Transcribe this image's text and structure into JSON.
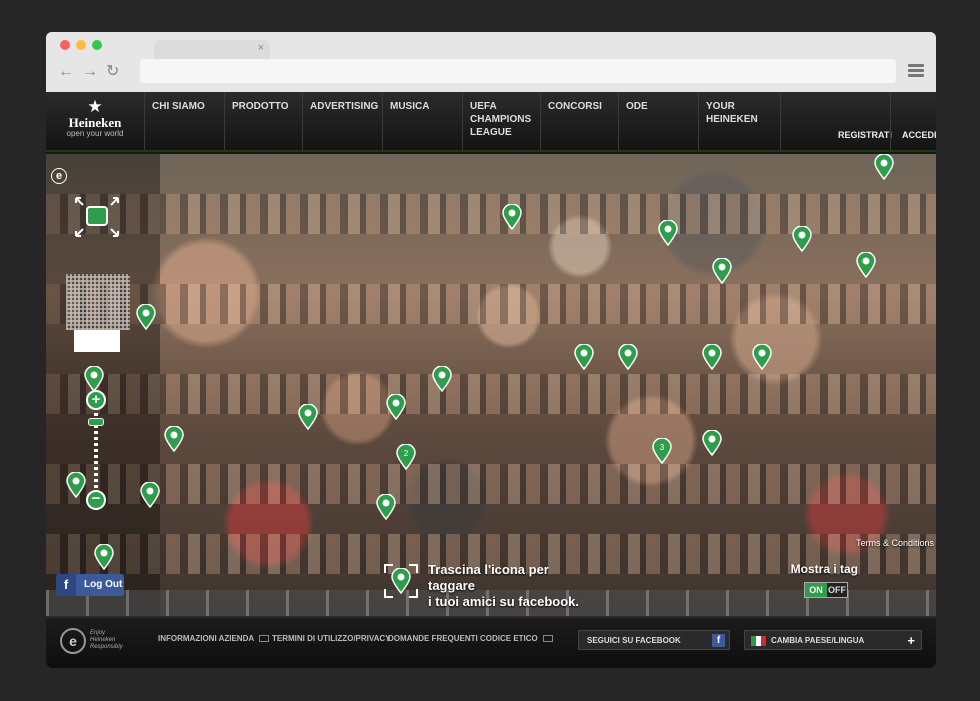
{
  "browser": {
    "tab_close": "×",
    "nav": {
      "back": "←",
      "forward": "→",
      "reload": "↻"
    }
  },
  "header": {
    "logo": {
      "brand": "Heineken",
      "tagline": "open your world"
    },
    "nav_items": [
      "CHI SIAMO",
      "PRODOTTO",
      "ADVERTISING",
      "MUSICA",
      "UEFA CHAMPIONS LEAGUE",
      "CONCORSI",
      "ODE",
      "YOUR HEINEKEN"
    ],
    "register": "REGISTRATI",
    "login": "ACCEDI"
  },
  "hero": {
    "logout_label": "Log Out",
    "drag_instruction_line1": "Trascina l'icona per taggare",
    "drag_instruction_line2": "i tuoi amici su facebook.",
    "terms_link": "Terms & Conditions",
    "show_tags_label": "Mostra i tag",
    "toggle_on": "ON",
    "toggle_off": "OFF",
    "zoom_in": "+",
    "zoom_out": "−",
    "pin_numbers": [
      "2",
      "3"
    ]
  },
  "footer": {
    "enjoy_text": "Enjoy Heineken Responsibly",
    "links": [
      "INFORMAZIONI AZIENDA",
      "TERMINI DI UTILIZZO/PRIVACY",
      "DOMANDE FREQUENTI",
      "CODICE ETICO"
    ],
    "facebook_button": "SEGUICI SU FACEBOOK",
    "language_button": "CAMBIA PAESE/LINGUA"
  },
  "colors": {
    "accent_green": "#2e9e4c",
    "facebook_blue": "#3b5a9a"
  }
}
